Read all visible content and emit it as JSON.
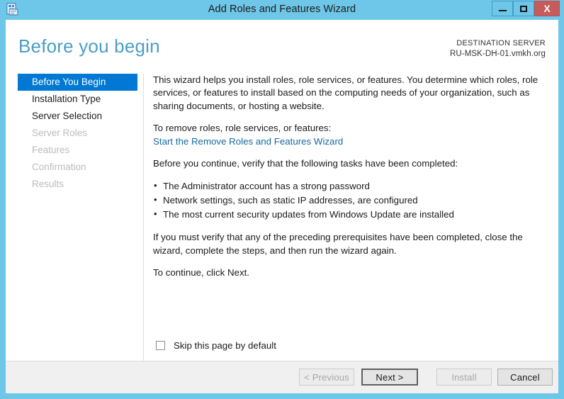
{
  "window": {
    "title": "Add Roles and Features Wizard",
    "icon": "server-manager-icon",
    "accent_color": "#6ec6e8",
    "controls": {
      "minimize_label": "Minimize",
      "maximize_label": "Maximize",
      "close_label": "X"
    }
  },
  "header": {
    "page_title": "Before you begin",
    "destination_label": "DESTINATION SERVER",
    "destination_server": "RU-MSK-DH-01.vmkh.org",
    "title_color": "#4a9ec4"
  },
  "sidebar": {
    "selected_color": "#0078d4",
    "items": [
      {
        "label": "Before You Begin",
        "state": "selected"
      },
      {
        "label": "Installation Type",
        "state": "enabled"
      },
      {
        "label": "Server Selection",
        "state": "enabled"
      },
      {
        "label": "Server Roles",
        "state": "disabled"
      },
      {
        "label": "Features",
        "state": "disabled"
      },
      {
        "label": "Confirmation",
        "state": "disabled"
      },
      {
        "label": "Results",
        "state": "disabled"
      }
    ]
  },
  "content": {
    "intro": "This wizard helps you install roles, role services, or features. You determine which roles, role services, or features to install based on the computing needs of your organization, such as sharing documents, or hosting a website.",
    "remove_prompt": "To remove roles, role services, or features:",
    "remove_link": "Start the Remove Roles and Features Wizard",
    "remove_link_color": "#16699e",
    "verify_prompt": "Before you continue, verify that the following tasks have been completed:",
    "tasks": [
      "The Administrator account has a strong password",
      "Network settings, such as static IP addresses, are configured",
      "The most current security updates from Windows Update are installed"
    ],
    "prereq_note": "If you must verify that any of the preceding prerequisites have been completed, close the wizard, complete the steps, and then run the wizard again.",
    "continue_note": "To continue, click Next."
  },
  "options": {
    "skip_label": "Skip this page by default",
    "skip_checked": false
  },
  "footer": {
    "buttons": [
      {
        "label": "< Previous",
        "state": "disabled"
      },
      {
        "label": "Next >",
        "state": "default"
      },
      {
        "label": "Install",
        "state": "disabled"
      },
      {
        "label": "Cancel",
        "state": "enabled"
      }
    ]
  }
}
